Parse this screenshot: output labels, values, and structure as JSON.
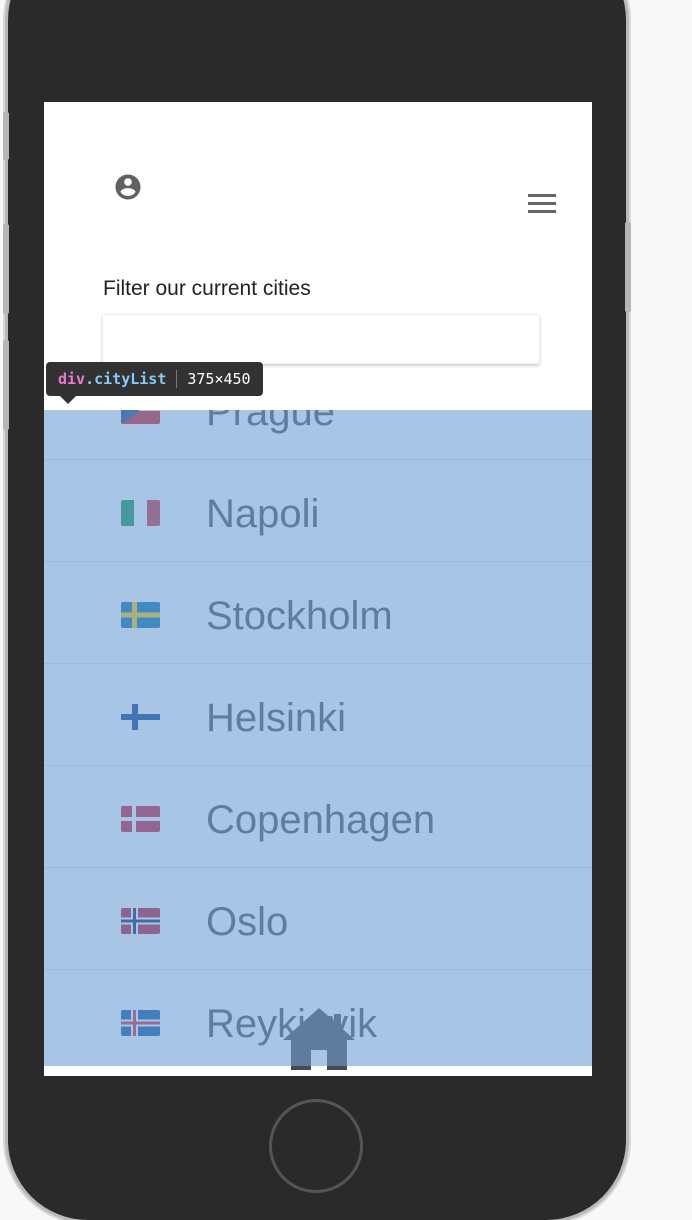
{
  "header": {
    "account_icon": "account-circle-icon",
    "menu_icon": "hamburger-menu-icon"
  },
  "filter": {
    "label": "Filter our current cities",
    "value": "",
    "placeholder": ""
  },
  "cities": [
    {
      "name": "Prague",
      "flag": "czech-flag"
    },
    {
      "name": "Napoli",
      "flag": "italy-flag"
    },
    {
      "name": "Stockholm",
      "flag": "sweden-flag"
    },
    {
      "name": "Helsinki",
      "flag": "finland-flag"
    },
    {
      "name": "Copenhagen",
      "flag": "denmark-flag"
    },
    {
      "name": "Oslo",
      "flag": "norway-flag"
    },
    {
      "name": "Reykjavik",
      "flag": "iceland-flag"
    }
  ],
  "bottom_nav": {
    "home_icon": "home-icon"
  },
  "inspector": {
    "tag": "div",
    "class_name": ".cityList",
    "size": "375×450",
    "highlight_color": "#6f9ed4"
  }
}
